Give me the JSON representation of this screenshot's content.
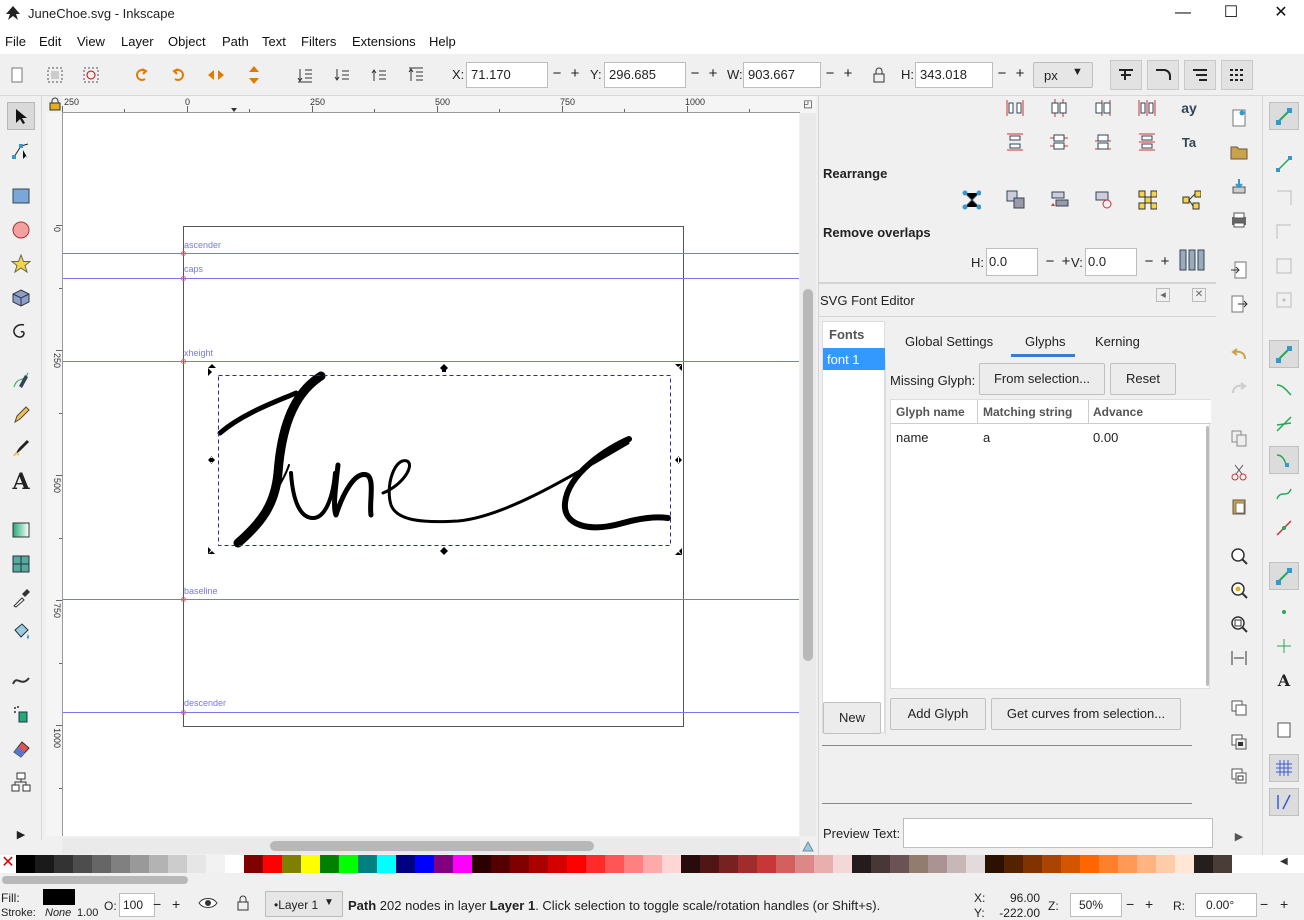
{
  "window": {
    "title": "JuneChoe.svg - Inkscape",
    "minimize": "—",
    "maximize": "☐",
    "close": "✕"
  },
  "menu": [
    "File",
    "Edit",
    "View",
    "Layer",
    "Object",
    "Path",
    "Text",
    "Filters",
    "Extensions",
    "Help"
  ],
  "toolbar": {
    "x_label": "X:",
    "x_value": "71.170",
    "y_label": "Y:",
    "y_value": "296.685",
    "w_label": "W:",
    "w_value": "903.667",
    "h_label": "H:",
    "h_value": "343.018",
    "unit": "px",
    "minus": "−",
    "plus": "+"
  },
  "ruler": {
    "h_ticks": [
      "250",
      "0",
      "250",
      "500",
      "750",
      "1000"
    ],
    "v_ticks": [
      "0",
      "250",
      "500",
      "750",
      "1000"
    ]
  },
  "guides": {
    "ascender": "ascender",
    "caps": "caps",
    "xheight": "xheight",
    "baseline": "baseline",
    "descender": "descender"
  },
  "align": {
    "rearrange": "Rearrange",
    "remove_overlaps": "Remove overlaps",
    "h_label": "H:",
    "h_value": "0.0",
    "v_label": "V:",
    "v_value": "0.0"
  },
  "font_editor": {
    "title": "SVG Font Editor",
    "fonts_header": "Fonts",
    "fonts": [
      "font 1"
    ],
    "tabs": [
      "Global Settings",
      "Glyphs",
      "Kerning"
    ],
    "active_tab": "Glyphs",
    "missing_glyph_label": "Missing Glyph:",
    "from_selection": "From selection...",
    "reset": "Reset",
    "columns": [
      "Glyph name",
      "Matching string",
      "Advance"
    ],
    "rows": [
      {
        "name": "name",
        "match": "a",
        "advance": "0.00"
      }
    ],
    "new_button": "New",
    "add_glyph": "Add Glyph",
    "get_curves": "Get curves from selection...",
    "preview_label": "Preview Text:",
    "preview_value": ""
  },
  "colors": {
    "guide": "#7878e8",
    "selection": "#2c2c8c",
    "tab_active": "#3b7ad8",
    "font_sel_bg": "#3399ff"
  },
  "palette": [
    "#000000",
    "#1a1a1a",
    "#333333",
    "#4d4d4d",
    "#666666",
    "#808080",
    "#999999",
    "#b3b3b3",
    "#cccccc",
    "#e6e6e6",
    "#f2f2f2",
    "#ffffff",
    "#800000",
    "#ff0000",
    "#808000",
    "#ffff00",
    "#008000",
    "#00ff00",
    "#008080",
    "#00ffff",
    "#000080",
    "#0000ff",
    "#800080",
    "#ff00ff",
    "#2b0000",
    "#550000",
    "#800000",
    "#aa0000",
    "#d40000",
    "#ff0000",
    "#ff2a2a",
    "#ff5555",
    "#ff8080",
    "#ffaaaa",
    "#ffd5d5",
    "#280b0b",
    "#501616",
    "#782121",
    "#a02c2c",
    "#c83737",
    "#d35f5f",
    "#de8787",
    "#e9afaf",
    "#f4d7d7",
    "#241c1c",
    "#483737",
    "#6c5353",
    "#917c6f",
    "#ac9393",
    "#c8b7b7",
    "#e3dbdb",
    "#2b1100",
    "#552200",
    "#803300",
    "#aa4400",
    "#d45500",
    "#ff6600",
    "#ff7f2a",
    "#ff9955",
    "#ffb380",
    "#ffccaa",
    "#ffe6d5",
    "#241f1c",
    "#483e37"
  ],
  "status": {
    "fill_label": "Fill:",
    "fill_color": "#000000",
    "stroke_label": "Stroke:",
    "stroke_value": "None",
    "stroke_width": "1.00",
    "opacity_label": "O:",
    "opacity_value": "100",
    "layer": "•Layer 1",
    "msg_bold1": "Path",
    "msg_part1": " 202 nodes in layer ",
    "msg_bold2": "Layer 1",
    "msg_part2": ". Click selection to toggle scale/rotation handles (or Shift+s).",
    "x_label": "X:",
    "x_value": "96.00",
    "y_label": "Y:",
    "y_value": "-222.00",
    "z_label": "Z:",
    "zoom": "50%",
    "r_label": "R:",
    "rotation": "0.00°"
  }
}
